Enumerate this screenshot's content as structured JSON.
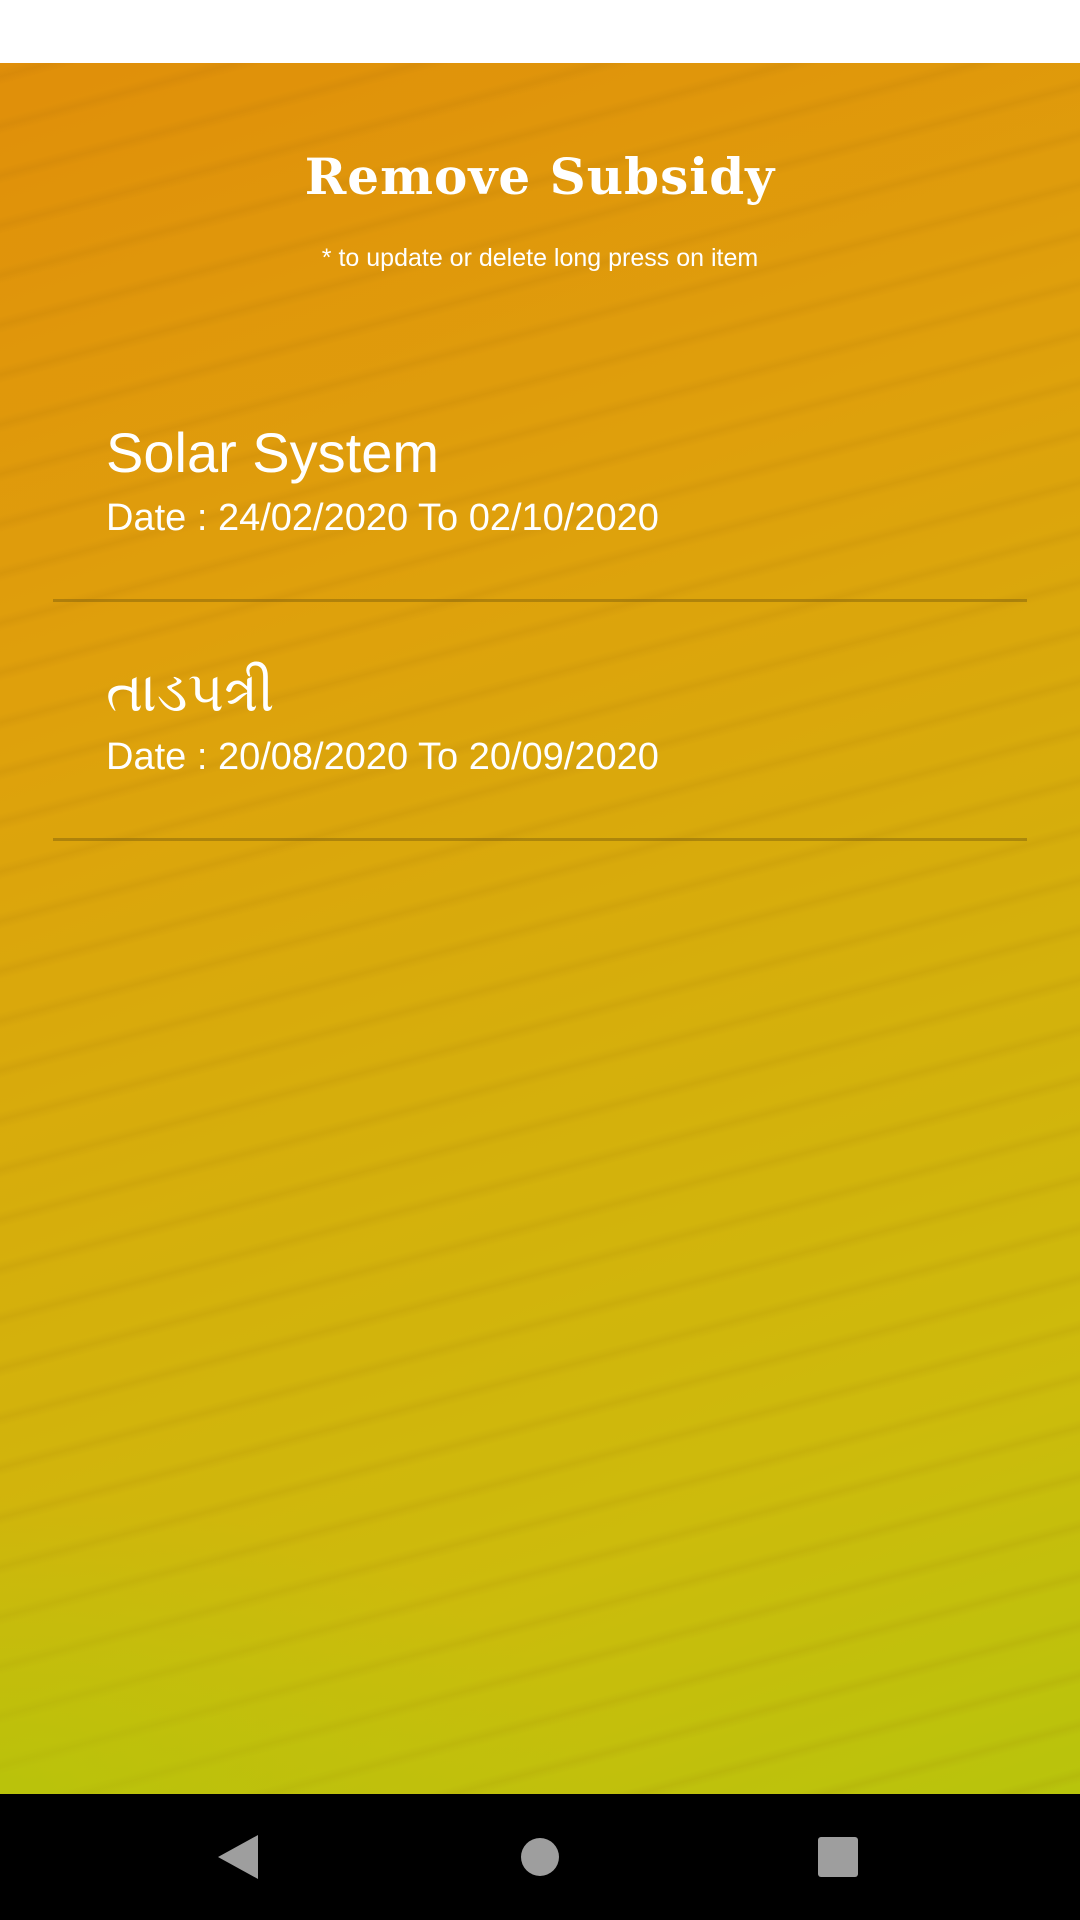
{
  "header": {
    "title": "Remove Subsidy",
    "hint": "* to update or delete long press on item"
  },
  "subsidies": [
    {
      "name": "Solar System",
      "date": "Date : 24/02/2020 To 02/10/2020"
    },
    {
      "name": "તાડપત્રી",
      "date": "Date : 20/08/2020 To 20/09/2020"
    }
  ],
  "nav": {
    "back_icon": "back-triangle-icon",
    "home_icon": "home-circle-icon",
    "recents_icon": "recents-square-icon"
  },
  "colors": {
    "gradient_top": "#e08f0a",
    "gradient_bottom": "#b8c40c",
    "text": "#ffffff",
    "nav_bar": "#000000",
    "nav_icon": "#9e9e9e"
  }
}
